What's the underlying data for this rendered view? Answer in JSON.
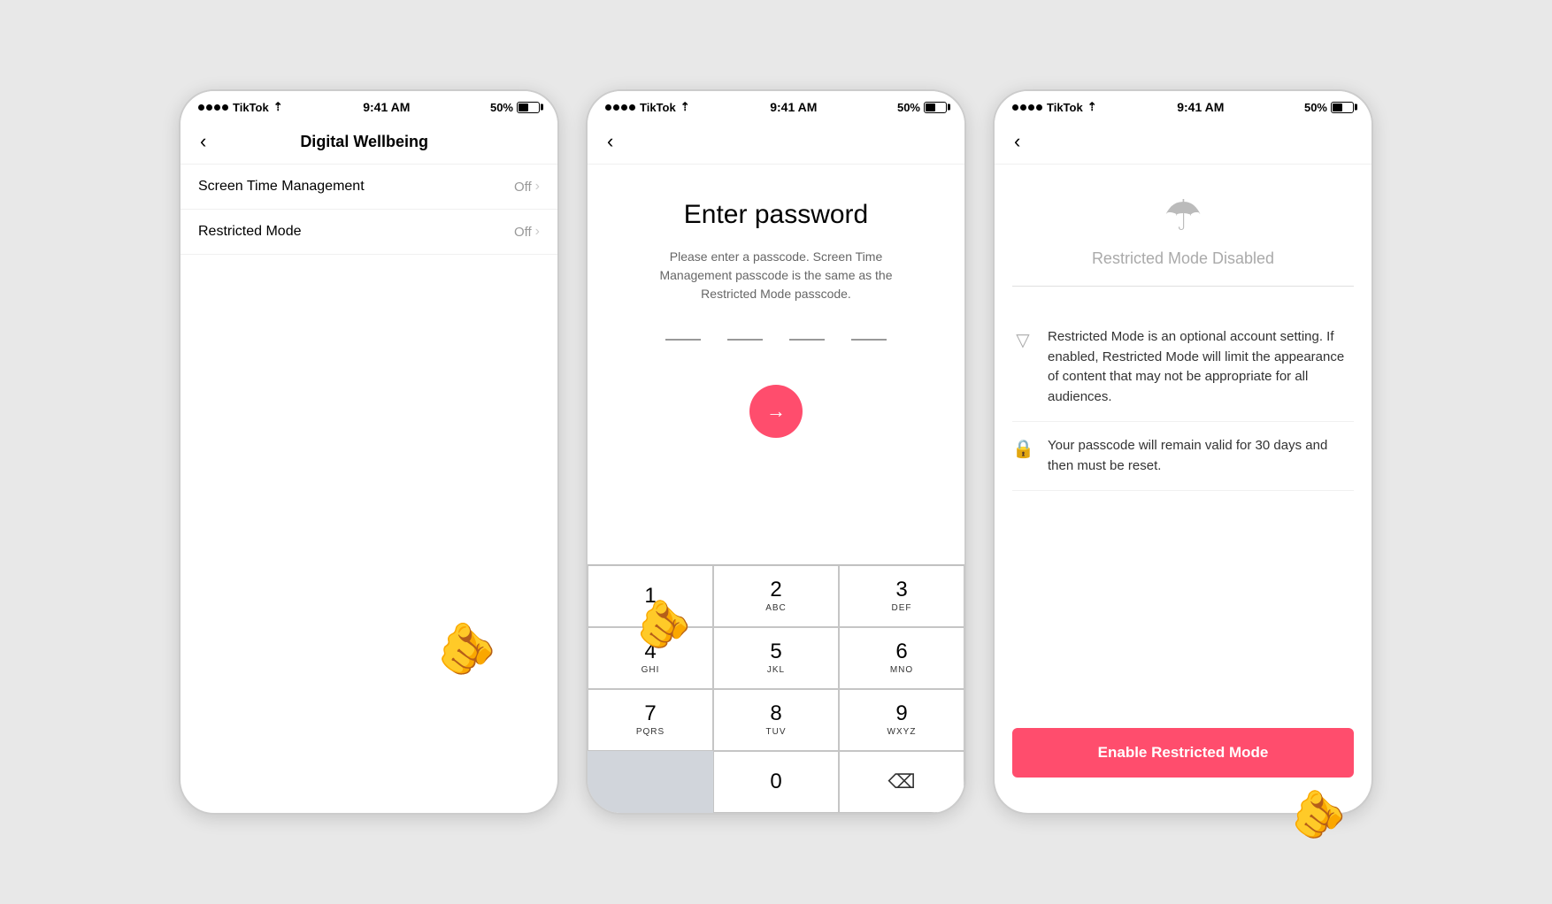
{
  "phones": [
    {
      "id": "phone1",
      "statusBar": {
        "signal": "●●●●○",
        "app": "TikTok",
        "wifi": "WiFi",
        "time": "9:41 AM",
        "battery": "50%"
      },
      "navTitle": "Digital Wellbeing",
      "settings": [
        {
          "label": "Screen Time Management",
          "value": "Off"
        },
        {
          "label": "Restricted Mode",
          "value": "Off"
        }
      ]
    },
    {
      "id": "phone2",
      "statusBar": {
        "app": "TikTok",
        "time": "9:41 AM",
        "battery": "50%"
      },
      "title": "Enter password",
      "subtitle": "Please enter a passcode. Screen Time Management passcode is the same as the Restricted Mode passcode.",
      "numpad": [
        {
          "number": "1",
          "letters": ""
        },
        {
          "number": "2",
          "letters": "ABC"
        },
        {
          "number": "3",
          "letters": "DEF"
        },
        {
          "number": "4",
          "letters": "GHI"
        },
        {
          "number": "5",
          "letters": "JKL"
        },
        {
          "number": "6",
          "letters": "MNO"
        },
        {
          "number": "7",
          "letters": "PQRS"
        },
        {
          "number": "8",
          "letters": "TUV"
        },
        {
          "number": "9",
          "letters": "WXYZ"
        },
        {
          "number": "",
          "letters": ""
        },
        {
          "number": "0",
          "letters": ""
        },
        {
          "number": "⌫",
          "letters": ""
        }
      ]
    },
    {
      "id": "phone3",
      "statusBar": {
        "app": "TikTok",
        "time": "9:41 AM",
        "battery": "50%"
      },
      "statusHeading": "Restricted Mode Disabled",
      "infoItems": [
        {
          "icon": "▽",
          "text": "Restricted Mode is an optional account setting. If enabled, Restricted Mode will limit the appearance of content that may not be appropriate for all audiences."
        },
        {
          "icon": "🔒",
          "text": "Your passcode will remain valid for 30 days and then must be reset."
        }
      ],
      "enableButton": "Enable Restricted Mode"
    }
  ]
}
